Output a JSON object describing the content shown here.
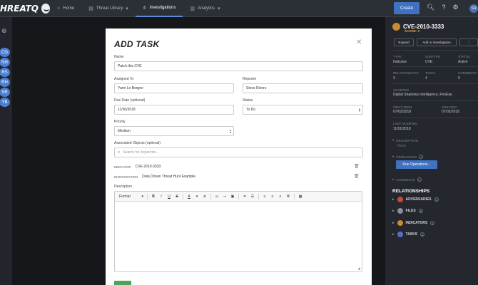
{
  "navbar": {
    "brand": "HREATQ",
    "items": [
      {
        "label": "Home",
        "icon": "home-icon",
        "glyph": "⌂"
      },
      {
        "label": "Threat Library",
        "icon": "library-icon",
        "glyph": "▤",
        "caret": "▾"
      },
      {
        "label": "Investigations",
        "icon": "investigations-icon",
        "glyph": "⋔"
      },
      {
        "label": "Analytics",
        "icon": "analytics-icon",
        "glyph": "▥",
        "caret": "▾"
      }
    ],
    "create_label": "Create",
    "avatar_initials": "SR"
  },
  "rail": {
    "avatars": [
      "CG",
      "NH",
      "RS",
      "RH",
      "SR",
      "YB"
    ]
  },
  "modal": {
    "title": "ADD TASK",
    "name_label": "Name",
    "name_value": "Patch this CVE",
    "assigned_label": "Assigned To",
    "assigned_value": "Yann Le Borgne",
    "reporter_label": "Reporter",
    "reporter_value": "Steve Rivers",
    "due_label": "Due Date (optional)",
    "due_value": "11/30/2018",
    "status_label": "Status",
    "status_value": "To Do",
    "priority_label": "Priority",
    "priority_value": "Medium",
    "assoc_label": "Associated Objects (optional)",
    "assoc_placeholder": "Search for keywords...",
    "associations": [
      {
        "type": "INDICATOR",
        "name": "CVE-2010-3333"
      },
      {
        "type": "INVESTIGATION",
        "name": "Data Driven Threat Hunt Example"
      }
    ],
    "description_label": "Description",
    "toolbar": {
      "format_label": "Format",
      "bold": "B",
      "italic": "I",
      "underline": "U",
      "strike": "S",
      "text_color": "A"
    }
  },
  "panel": {
    "title": "CVE-2010-3333",
    "score": "SCORE: 0",
    "buttons": [
      "Expand",
      "Add to Investigation",
      "⋮"
    ],
    "type_label": "TYPE",
    "type_value": "Indicator",
    "subtype_label": "SUBTYPE",
    "subtype_value": "CVE",
    "status_label": "STATUS",
    "status_value": "Active",
    "relationships_label": "RELATIONSHIPS",
    "relationships_value": "3",
    "tasks_label": "TASKS",
    "tasks_value": "4",
    "comments_label": "COMMENTS",
    "comments_value": "0",
    "sources_label": "SOURCES",
    "sources_value": "Digital Shadows Intelligence, FireEye",
    "first_seen_label": "FIRST SEEN",
    "first_seen_value": "07/02/2018",
    "created_label": "CREATED",
    "created_value": "07/02/2018",
    "last_modified_label": "LAST MODIFIED",
    "last_modified_value": "11/01/2018",
    "description_section": "DESCRIPTION",
    "description_value": "None",
    "operations_section": "OPERATIONS",
    "run_ops_label": "Run Operations...",
    "comments_section": "COMMENTS",
    "rel_title": "RELATIONSHIPS",
    "rel_items": [
      {
        "label": "ADVERSARIES",
        "count": "0",
        "color": "#c94a3a"
      },
      {
        "label": "FILES",
        "count": "0",
        "color": "#8a8f98"
      },
      {
        "label": "INDICATORS",
        "count": "1",
        "color": "#c98a32"
      },
      {
        "label": "TASKS",
        "count": "4",
        "color": "#5b6bc9"
      }
    ]
  }
}
